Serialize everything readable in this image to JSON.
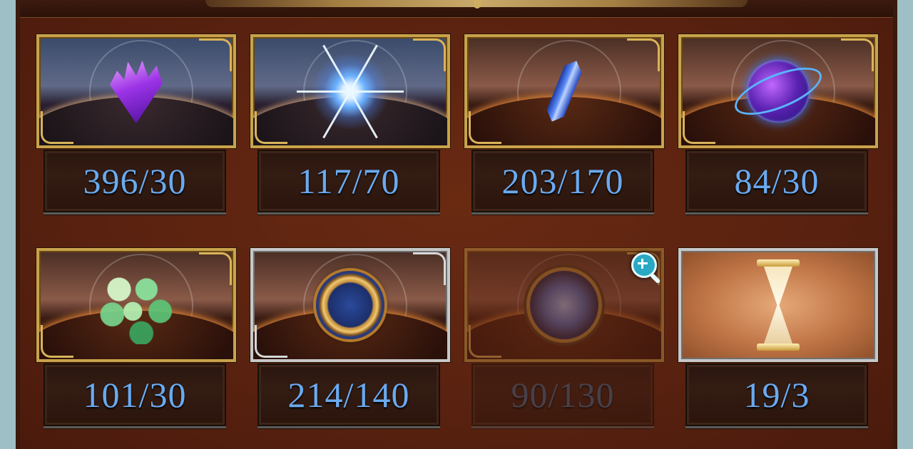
{
  "items": [
    {
      "name": "purple-crystal",
      "count": "396/30",
      "icon": "crystal-icon"
    },
    {
      "name": "starlight-burst",
      "count": "117/70",
      "icon": "star-icon"
    },
    {
      "name": "blue-gem",
      "count": "203/170",
      "icon": "gem-icon"
    },
    {
      "name": "cosmic-orb",
      "count": "84/30",
      "icon": "orb-icon"
    },
    {
      "name": "hex-fragment",
      "count": "101/30",
      "icon": "hex-icon"
    },
    {
      "name": "golden-medallion",
      "count": "214/140",
      "icon": "medallion-icon"
    },
    {
      "name": "spiral-compass",
      "count": "90/130",
      "icon": "compass-icon",
      "disabled": true
    },
    {
      "name": "golden-hourglass",
      "count": "19/3",
      "icon": "hourglass-icon"
    }
  ],
  "colors": {
    "panel": "#5a2210",
    "count_text": "#6aaaf0",
    "frame_gold": "#c9a34a",
    "frame_silver": "#c8c8c8",
    "background": "#9fbfc6"
  }
}
